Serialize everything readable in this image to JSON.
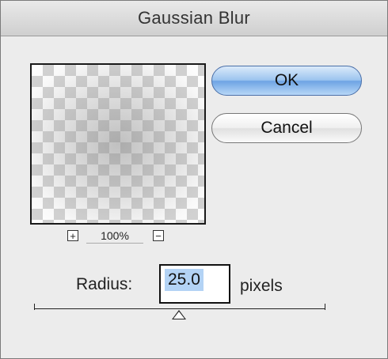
{
  "window": {
    "title": "Gaussian Blur"
  },
  "preview": {
    "zoom_in_icon": "plus-icon",
    "zoom_out_icon": "minus-icon",
    "zoom_level": "100%"
  },
  "buttons": {
    "ok_label": "OK",
    "cancel_label": "Cancel"
  },
  "radius": {
    "label": "Radius:",
    "value": "25.0",
    "units": "pixels"
  },
  "colors": {
    "ok_accent": "#6ea4e4",
    "selection": "#b3d3f5"
  }
}
